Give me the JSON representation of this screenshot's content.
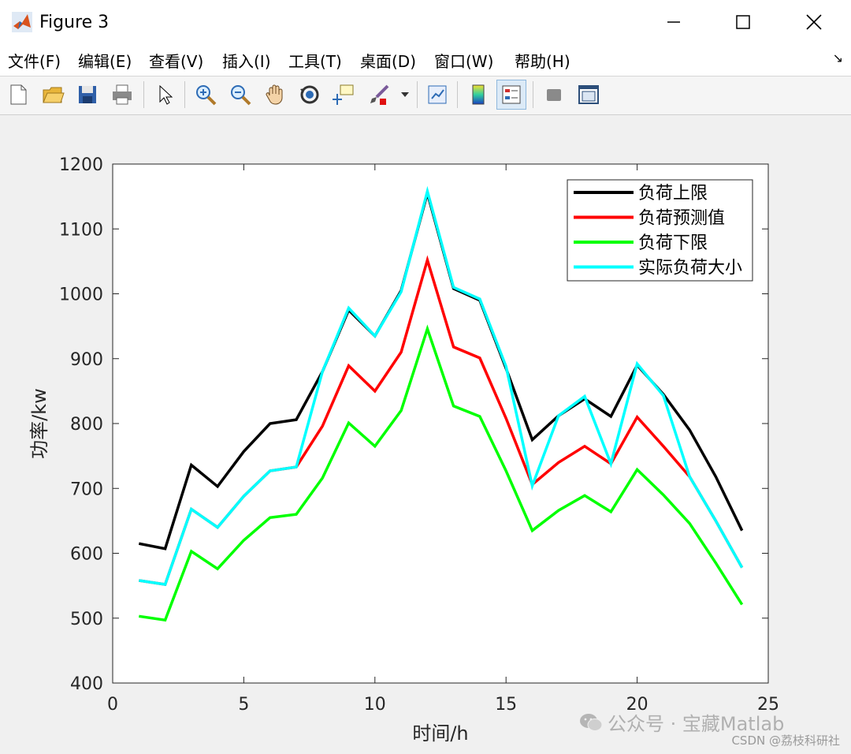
{
  "window": {
    "title": "Figure 3"
  },
  "menu": [
    {
      "label": "文件(F)"
    },
    {
      "label": "编辑(E)"
    },
    {
      "label": "查看(V)"
    },
    {
      "label": "插入(I)"
    },
    {
      "label": "工具(T)"
    },
    {
      "label": "桌面(D)"
    },
    {
      "label": "窗口(W)"
    },
    {
      "label": "帮助(H)"
    }
  ],
  "toolbar": {
    "buttons": [
      {
        "icon": "new-figure-icon"
      },
      {
        "icon": "open-file-icon"
      },
      {
        "icon": "save-icon"
      },
      {
        "icon": "print-icon"
      },
      {
        "icon": "pointer-icon"
      },
      {
        "icon": "zoom-in-icon"
      },
      {
        "icon": "zoom-out-icon"
      },
      {
        "icon": "pan-icon"
      },
      {
        "icon": "rotate-3d-icon"
      },
      {
        "icon": "data-cursor-icon"
      },
      {
        "icon": "brush-icon"
      },
      {
        "icon": "link-plot-icon"
      },
      {
        "icon": "colorbar-icon"
      },
      {
        "icon": "legend-icon"
      },
      {
        "icon": "hide-plot-tools-icon"
      },
      {
        "icon": "show-plot-tools-icon"
      }
    ]
  },
  "chart_data": {
    "type": "line",
    "xlabel": "时间/h",
    "ylabel": "功率/kw",
    "xlim": [
      0,
      25
    ],
    "ylim": [
      400,
      1200
    ],
    "xticks": [
      0,
      5,
      10,
      15,
      20,
      25
    ],
    "yticks": [
      400,
      500,
      600,
      700,
      800,
      900,
      1000,
      1100,
      1200
    ],
    "legend_position": "top-right",
    "grid": false,
    "x": [
      1,
      2,
      3,
      4,
      5,
      6,
      7,
      8,
      9,
      10,
      11,
      12,
      13,
      14,
      15,
      16,
      17,
      18,
      19,
      20,
      21,
      22,
      23,
      24
    ],
    "series": [
      {
        "name": "负荷上限",
        "color": "#000000",
        "values": [
          615,
          607,
          736,
          703,
          757,
          800,
          806,
          880,
          975,
          935,
          1005,
          1155,
          1008,
          990,
          885,
          775,
          812,
          838,
          811,
          890,
          845,
          790,
          718,
          635
        ]
      },
      {
        "name": "负荷预测值",
        "color": "#ff0000",
        "values": [
          558,
          552,
          668,
          640,
          688,
          727,
          733,
          796,
          889,
          850,
          910,
          1052,
          918,
          901,
          808,
          706,
          740,
          765,
          738,
          810,
          765,
          718,
          650,
          578
        ]
      },
      {
        "name": "负荷下限",
        "color": "#00ff00",
        "values": [
          503,
          497,
          603,
          576,
          620,
          655,
          660,
          716,
          801,
          765,
          820,
          946,
          827,
          811,
          727,
          635,
          666,
          689,
          664,
          729,
          690,
          646,
          585,
          521
        ]
      },
      {
        "name": "实际负荷大小",
        "color": "#00ffff",
        "values": [
          558,
          552,
          668,
          640,
          688,
          727,
          733,
          880,
          978,
          935,
          1003,
          1158,
          1010,
          992,
          888,
          704,
          812,
          842,
          738,
          892,
          843,
          718,
          650,
          578
        ]
      }
    ]
  },
  "watermark": {
    "text": "公众号 · 宝藏Matlab"
  },
  "csdn": {
    "text": "CSDN @荔枝科研社"
  }
}
